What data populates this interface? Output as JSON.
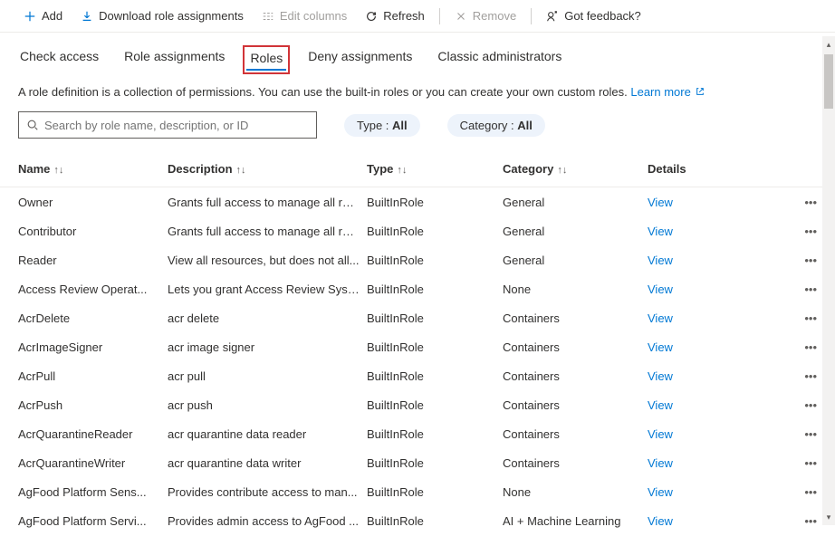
{
  "toolbar": {
    "add": "Add",
    "download": "Download role assignments",
    "edit_columns": "Edit columns",
    "refresh": "Refresh",
    "remove": "Remove",
    "feedback": "Got feedback?"
  },
  "tabs": {
    "check_access": "Check access",
    "role_assignments": "Role assignments",
    "roles": "Roles",
    "deny_assignments": "Deny assignments",
    "classic_admins": "Classic administrators"
  },
  "description": {
    "text": "A role definition is a collection of permissions. You can use the built-in roles or you can create your own custom roles. ",
    "learn_more": "Learn more"
  },
  "search": {
    "placeholder": "Search by role name, description, or ID"
  },
  "filters": {
    "type_label": "Type : ",
    "type_value": "All",
    "category_label": "Category : ",
    "category_value": "All"
  },
  "columns": {
    "name": "Name",
    "description": "Description",
    "type": "Type",
    "category": "Category",
    "details": "Details"
  },
  "view_label": "View",
  "rows": [
    {
      "name": "Owner",
      "description": "Grants full access to manage all res...",
      "type": "BuiltInRole",
      "category": "General"
    },
    {
      "name": "Contributor",
      "description": "Grants full access to manage all res...",
      "type": "BuiltInRole",
      "category": "General"
    },
    {
      "name": "Reader",
      "description": "View all resources, but does not all...",
      "type": "BuiltInRole",
      "category": "General"
    },
    {
      "name": "Access Review Operat...",
      "description": "Lets you grant Access Review Syste...",
      "type": "BuiltInRole",
      "category": "None"
    },
    {
      "name": "AcrDelete",
      "description": "acr delete",
      "type": "BuiltInRole",
      "category": "Containers"
    },
    {
      "name": "AcrImageSigner",
      "description": "acr image signer",
      "type": "BuiltInRole",
      "category": "Containers"
    },
    {
      "name": "AcrPull",
      "description": "acr pull",
      "type": "BuiltInRole",
      "category": "Containers"
    },
    {
      "name": "AcrPush",
      "description": "acr push",
      "type": "BuiltInRole",
      "category": "Containers"
    },
    {
      "name": "AcrQuarantineReader",
      "description": "acr quarantine data reader",
      "type": "BuiltInRole",
      "category": "Containers"
    },
    {
      "name": "AcrQuarantineWriter",
      "description": "acr quarantine data writer",
      "type": "BuiltInRole",
      "category": "Containers"
    },
    {
      "name": "AgFood Platform Sens...",
      "description": "Provides contribute access to man...",
      "type": "BuiltInRole",
      "category": "None"
    },
    {
      "name": "AgFood Platform Servi...",
      "description": "Provides admin access to AgFood ...",
      "type": "BuiltInRole",
      "category": "AI + Machine Learning"
    }
  ]
}
